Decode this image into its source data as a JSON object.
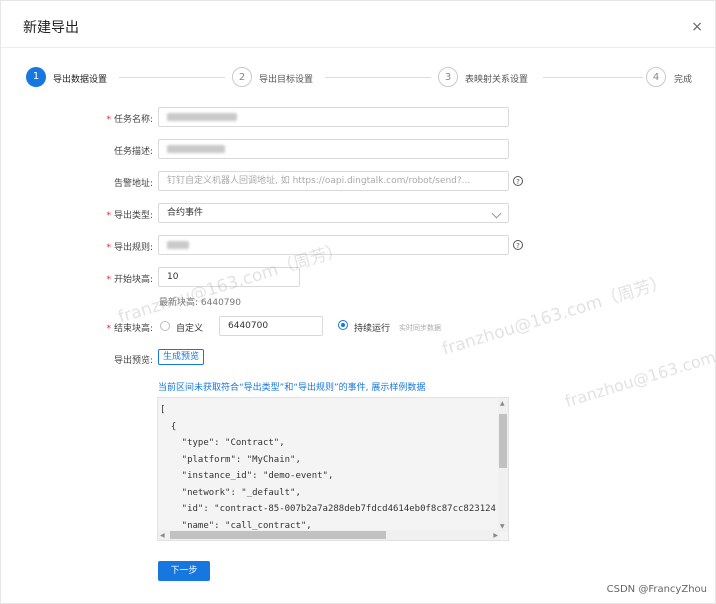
{
  "dialog": {
    "title": "新建导出",
    "close_glyph": "×",
    "close_icon": "close-icon"
  },
  "steps": [
    {
      "num": "1",
      "label": "导出数据设置",
      "active": true
    },
    {
      "num": "2",
      "label": "导出目标设置",
      "active": false
    },
    {
      "num": "3",
      "label": "表映射关系设置",
      "active": false
    },
    {
      "num": "4",
      "label": "完成",
      "active": false
    }
  ],
  "form": {
    "task_name": {
      "label": "任务名称:",
      "required": true,
      "value": ""
    },
    "task_desc": {
      "label": "任务描述:",
      "required": false,
      "value": ""
    },
    "alert_addr": {
      "label": "告警地址:",
      "required": false,
      "placeholder": "钉钉自定义机器人回调地址, 如 https://oapi.dingtalk.com/robot/send?...",
      "help_icon": "question-circle-icon",
      "help_glyph": "?"
    },
    "export_type": {
      "label": "导出类型:",
      "required": true,
      "value": "合约事件",
      "dropdown_icon": "chevron-down-icon"
    },
    "export_rule": {
      "label": "导出规则:",
      "required": true,
      "value": "",
      "help_glyph": "?"
    },
    "start_block": {
      "label": "开始块高:",
      "required": true,
      "value": "10",
      "hint": "最新块高: 6440790"
    },
    "end_block": {
      "label": "结束块高:",
      "required": true,
      "custom_label": "自定义",
      "custom_value": "6440700",
      "continuous_label": "持续运行",
      "continuous_hint": "实时同步数据",
      "selected": "continuous"
    },
    "preview": {
      "label": "导出预览:",
      "button": "生成预览"
    }
  },
  "notice": "当前区间未获取符合“导出类型”和“导出规则”的事件, 展示样例数据",
  "code_lines": [
    "[",
    "  {",
    "    \"type\": \"Contract\",",
    "    \"platform\": \"MyChain\",",
    "    \"instance_id\": \"demo-event\",",
    "    \"network\": \"_default\",",
    "    \"id\": \"contract-85-007b2a7a288deb7fdcd4614eb0f8c87cc823124",
    "    \"name\": \"call_contract\","
  ],
  "next_button": "下一步",
  "watermarks": [
    "franzhou@163.com（周芳）",
    "franzhou@163.com（周芳）",
    "franzhou@163.com（周"
  ],
  "credit": "CSDN @FrancyZhou",
  "colors": {
    "primary": "#1677e0",
    "required": "#e23"
  }
}
